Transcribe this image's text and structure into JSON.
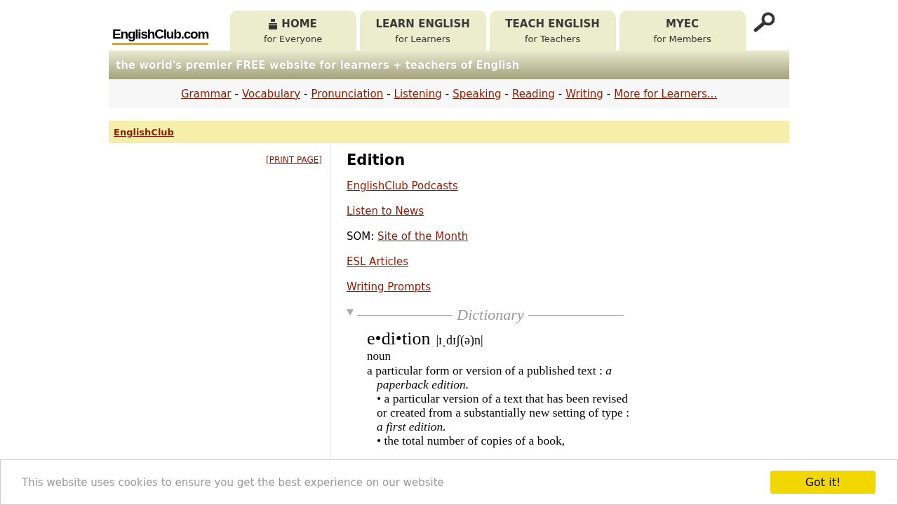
{
  "logo": "EnglishClub.com",
  "tabs": [
    {
      "title": "HOME",
      "subtitle": "for Everyone",
      "kind": "icon"
    },
    {
      "title": "LEARN ENGLISH",
      "subtitle": "for Learners",
      "kind": "plain"
    },
    {
      "title": "TEACH ENGLISH",
      "subtitle": "for Teachers",
      "kind": "plain"
    },
    {
      "title": "MYEC",
      "subtitle": "for Members",
      "kind": "plain"
    }
  ],
  "tagline": "the world's premier FREE website for learners + teachers of English",
  "nav": {
    "links": [
      "Grammar",
      "Vocabulary",
      "Pronunciation",
      "Listening",
      "Speaking",
      "Reading",
      "Writing",
      "More for Learners..."
    ],
    "separators": [
      "-",
      "-",
      "-",
      "-",
      "-",
      "-",
      "-"
    ]
  },
  "breadcrumb": "EnglishClub",
  "print_link": "[PRINT PAGE]",
  "heading": "Edition",
  "links": [
    {
      "label": "EnglishClub Podcasts"
    },
    {
      "label": "Listen to News"
    },
    {
      "prefix": "SOM:",
      "label": "Site of the Month"
    },
    {
      "label": "ESL Articles"
    },
    {
      "label": "Writing Prompts"
    }
  ],
  "dictionary": {
    "title": "Dictionary",
    "headword": "e•di•tion",
    "pronunciation": "|ɪˌdɪʃ(ə)n|",
    "part_of_speech": "noun",
    "senses": [
      {
        "kind": "main",
        "text": "a particular form or version of a published text : *a paperback edition.*"
      },
      {
        "kind": "sub",
        "text": "• a particular version of a text that has been revised or created from a substantially new setting of type : *a first edition.*"
      },
      {
        "kind": "sub",
        "text": "• the total number of copies of a book,"
      }
    ]
  },
  "cookie": {
    "message": "This website uses cookies to ensure you get the best experience on our website",
    "button": "Got it!"
  }
}
